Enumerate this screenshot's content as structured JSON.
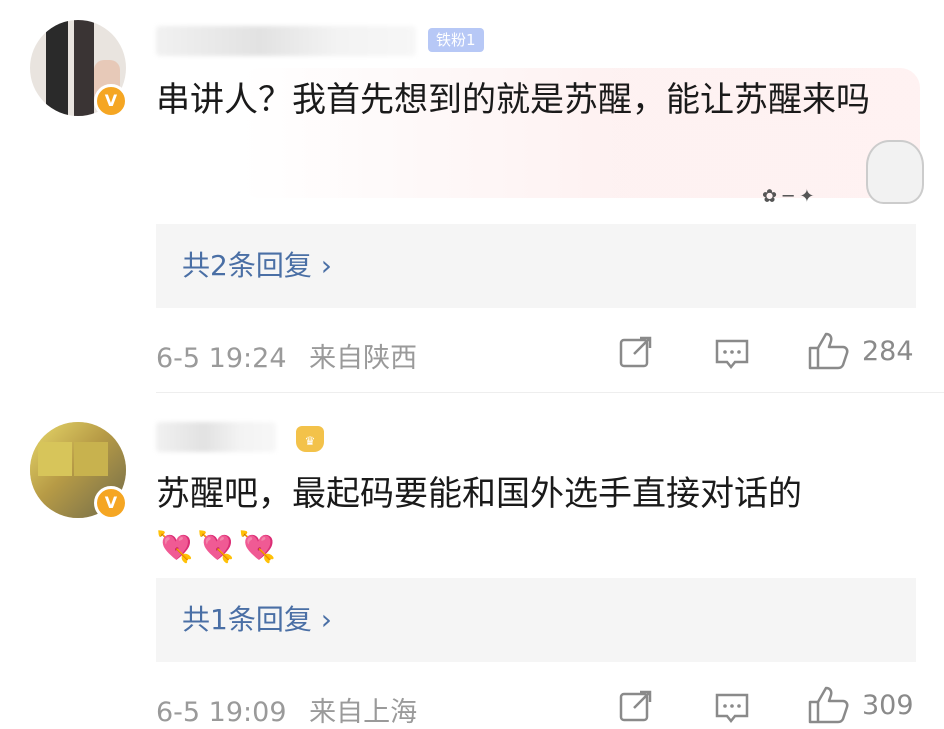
{
  "comments": [
    {
      "badge_fan": "铁粉1",
      "text": "串讲人？我首先想到的就是苏醒，能让苏醒来吗",
      "replies_label": "共2条回复 ›",
      "time": "6-5 19:24",
      "location": "来自陕西",
      "likes": "284",
      "verified": "V"
    },
    {
      "text": "苏醒吧，最起码要能和国外选手直接对话的",
      "emojis": [
        "💘",
        "💘",
        "💘"
      ],
      "replies_label": "共1条回复 ›",
      "time": "6-5 19:09",
      "location": "来自上海",
      "likes": "309",
      "verified": "V"
    }
  ],
  "colors": {
    "link": "#4a6fa5",
    "meta": "#9a9a9a",
    "verified_badge": "#f5a623",
    "reply_bg": "#f5f5f5"
  },
  "icons": [
    "share-icon",
    "comment-icon",
    "like-icon",
    "verified-icon",
    "crown-icon"
  ]
}
